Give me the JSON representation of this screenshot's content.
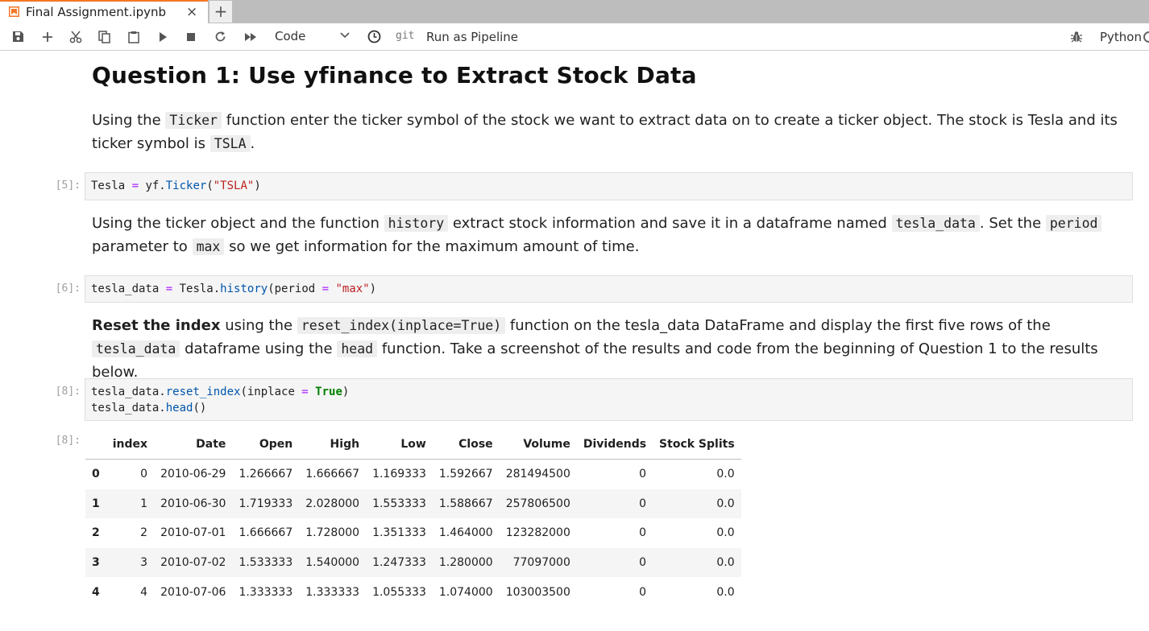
{
  "tab": {
    "title": "Final Assignment.ipynb",
    "close": "×",
    "new": "+"
  },
  "toolbar": {
    "cell_type": "Code",
    "git": "git",
    "run_pipeline": "Run as Pipeline",
    "kernel": "Python",
    "icons": [
      "save-icon",
      "add-icon",
      "cut-icon",
      "copy-icon",
      "paste-icon",
      "run-icon",
      "stop-icon",
      "restart-icon",
      "fast-forward-icon",
      "chevron-down-icon",
      "clock-icon",
      "bug-icon"
    ]
  },
  "cells": {
    "heading": "Question 1: Use yfinance to Extract Stock Data",
    "md1": {
      "t1": "Using the",
      "c1": "Ticker",
      "t2": "function enter the ticker symbol of the stock we want to extract data on to create a ticker object. The stock is Tesla and its ticker symbol is",
      "c2": "TSLA",
      "t3": "."
    },
    "p5": "[5]:",
    "code5": {
      "a": "Tesla ",
      "b": "=",
      "c": " yf.",
      "d": "Ticker",
      "e": "(",
      "f": "\"TSLA\"",
      "g": ")"
    },
    "md2": {
      "t1": "Using the ticker object and the function",
      "c1": "history",
      "t2": "extract stock information and save it in a dataframe named",
      "c2": "tesla_data",
      "t3": ". Set the",
      "c3": "period",
      "t4": "parameter to",
      "c4": "max",
      "t5": "so we get information for the maximum amount of time."
    },
    "p6": "[6]:",
    "code6": {
      "a": "tesla_data ",
      "b": "=",
      "c": " Tesla.",
      "d": "history",
      "e": "(period ",
      "f": "=",
      "g": " ",
      "h": "\"max\"",
      "i": ")"
    },
    "md3": {
      "b1": "Reset the index",
      "t1": "using the",
      "c1": "reset_index(inplace=True)",
      "t2": "function on the tesla_data DataFrame and display the first five rows of the",
      "c2": "tesla_data",
      "t3": "dataframe using the",
      "c3": "head",
      "t4": "function. Take a screenshot of the results and code from the beginning of Question 1 to the results below."
    },
    "p8": "[8]:",
    "code8": {
      "l1a": "tesla_data.",
      "l1b": "reset_index",
      "l1c": "(inplace ",
      "l1d": "=",
      "l1e": " ",
      "l1f": "True",
      "l1g": ")",
      "l2a": "tesla_data.",
      "l2b": "head",
      "l2c": "()"
    },
    "p8out": "[8]:"
  },
  "table": {
    "columns": [
      "",
      "index",
      "Date",
      "Open",
      "High",
      "Low",
      "Close",
      "Volume",
      "Dividends",
      "Stock Splits"
    ],
    "rows": [
      [
        "0",
        "0",
        "2010-06-29",
        "1.266667",
        "1.666667",
        "1.169333",
        "1.592667",
        "281494500",
        "0",
        "0.0"
      ],
      [
        "1",
        "1",
        "2010-06-30",
        "1.719333",
        "2.028000",
        "1.553333",
        "1.588667",
        "257806500",
        "0",
        "0.0"
      ],
      [
        "2",
        "2",
        "2010-07-01",
        "1.666667",
        "1.728000",
        "1.351333",
        "1.464000",
        "123282000",
        "0",
        "0.0"
      ],
      [
        "3",
        "3",
        "2010-07-02",
        "1.533333",
        "1.540000",
        "1.247333",
        "1.280000",
        "77097000",
        "0",
        "0.0"
      ],
      [
        "4",
        "4",
        "2010-07-06",
        "1.333333",
        "1.333333",
        "1.055333",
        "1.074000",
        "103003500",
        "0",
        "0.0"
      ]
    ]
  }
}
